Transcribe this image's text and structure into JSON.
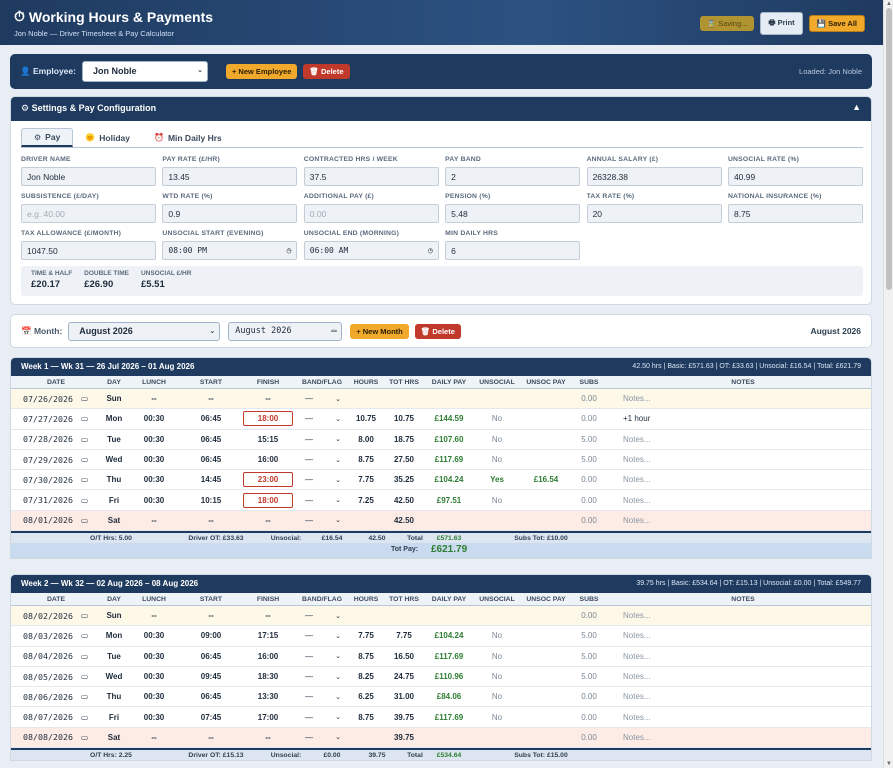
{
  "app": {
    "title": "Working Hours & Payments",
    "subtitle": "Jon Noble — Driver Timesheet & Pay Calculator",
    "saving": "Saving...",
    "print": "Print",
    "save_all": "Save All"
  },
  "employee": {
    "label": "Employee:",
    "selected": "Jon Noble",
    "new_button": "+ New Employee",
    "delete_button": "Delete",
    "loaded": "Loaded: Jon Noble"
  },
  "settings": {
    "title": "Settings & Pay Configuration",
    "tabs": [
      {
        "label": "Pay",
        "icon": "gear-icon"
      },
      {
        "label": "Holiday",
        "icon": "sun-icon"
      },
      {
        "label": "Min Daily Hrs",
        "icon": "alarm-clock-icon"
      }
    ],
    "fields": [
      {
        "label": "DRIVER NAME",
        "value": "Jon Noble"
      },
      {
        "label": "PAY RATE (£/HR)",
        "value": "13.45"
      },
      {
        "label": "CONTRACTED HRS / WEEK",
        "value": "37.5"
      },
      {
        "label": "PAY BAND",
        "value": "2"
      },
      {
        "label": "ANNUAL SALARY (£)",
        "value": "26328.38"
      },
      {
        "label": "UNSOCIAL RATE (%)",
        "value": "40.99"
      },
      {
        "label": "SUBSISTENCE (£/DAY)",
        "placeholder": "e.g. 40.00"
      },
      {
        "label": "WTD RATE (%)",
        "value": "0.9"
      },
      {
        "label": "ADDITIONAL PAY (£)",
        "placeholder": "0.00"
      },
      {
        "label": "PENSION (%)",
        "value": "5.48"
      },
      {
        "label": "TAX RATE (%)",
        "value": "20"
      },
      {
        "label": "NATIONAL INSURANCE (%)",
        "value": "8.75"
      },
      {
        "label": "TAX ALLOWANCE (£/MONTH)",
        "value": "1047.50"
      },
      {
        "label": "UNSOCIAL START (EVENING)",
        "value": "08:00 PM",
        "type": "time"
      },
      {
        "label": "UNSOCIAL END (MORNING)",
        "value": "06:00 AM",
        "type": "time"
      },
      {
        "label": "MIN DAILY HRS",
        "value": "6"
      }
    ],
    "rates": [
      {
        "label": "TIME & HALF",
        "value": "£20.17"
      },
      {
        "label": "DOUBLE TIME",
        "value": "£26.90"
      },
      {
        "label": "UNSOCIAL £/HR",
        "value": "£5.51"
      }
    ]
  },
  "month": {
    "label": "Month:",
    "selected": "August 2026",
    "input_value": "August 2026",
    "new_button": "+ New Month",
    "delete_button": "Delete",
    "current": "August 2026"
  },
  "columns": [
    "DATE",
    "DAY",
    "LUNCH",
    "START",
    "FINISH",
    "BAND/FLAG",
    "HOURS",
    "TOT HRS",
    "DAILY PAY",
    "UNSOCIAL",
    "UNSOC PAY",
    "SUBS",
    "NOTES"
  ],
  "weeks": [
    {
      "title": "Week 1 — Wk 31 — 26 Jul 2026 – 01 Aug 2026",
      "stats": "42.50 hrs | Basic: £571.63 | OT: £33.63 | Unsocial: £16.54 | Total: £621.79",
      "rows": [
        {
          "date": "07/26/2026",
          "day": "Sun",
          "lunch": "--",
          "start": "--",
          "finish": "--",
          "band": "—",
          "hours": "",
          "tot": "",
          "pay": "",
          "unsoc": "",
          "unsocpay": "",
          "subs": "0.00",
          "notes": "Notes...",
          "kind": "sun"
        },
        {
          "date": "07/27/2026",
          "day": "Mon",
          "lunch": "00:30",
          "start": "06:45",
          "finish": "18:00",
          "flag": true,
          "band": "—",
          "hours": "10.75",
          "tot": "10.75",
          "pay": "£144.59",
          "unsoc": "No",
          "unsocpay": "",
          "subs": "0.00",
          "notes": "+1 hour",
          "notes_filled": true
        },
        {
          "date": "07/28/2026",
          "day": "Tue",
          "lunch": "00:30",
          "start": "06:45",
          "finish": "15:15",
          "band": "—",
          "hours": "8.00",
          "tot": "18.75",
          "pay": "£107.60",
          "unsoc": "No",
          "unsocpay": "",
          "subs": "5.00",
          "notes": "Notes..."
        },
        {
          "date": "07/29/2026",
          "day": "Wed",
          "lunch": "00:30",
          "start": "06:45",
          "finish": "16:00",
          "band": "—",
          "hours": "8.75",
          "tot": "27.50",
          "pay": "£117.69",
          "unsoc": "No",
          "unsocpay": "",
          "subs": "5.00",
          "notes": "Notes..."
        },
        {
          "date": "07/30/2026",
          "day": "Thu",
          "lunch": "00:30",
          "start": "14:45",
          "finish": "23:00",
          "flag": true,
          "band": "—",
          "hours": "7.75",
          "tot": "35.25",
          "pay": "£104.24",
          "unsoc": "Yes",
          "unsocpay": "£16.54",
          "subs": "0.00",
          "notes": "Notes..."
        },
        {
          "date": "07/31/2026",
          "day": "Fri",
          "lunch": "00:30",
          "start": "10:15",
          "finish": "18:00",
          "flag": true,
          "band": "—",
          "hours": "7.25",
          "tot": "42.50",
          "pay": "£97.51",
          "unsoc": "No",
          "unsocpay": "",
          "subs": "0.00",
          "notes": "Notes..."
        },
        {
          "date": "08/01/2026",
          "day": "Sat",
          "lunch": "--",
          "start": "--",
          "finish": "--",
          "band": "—",
          "hours": "",
          "tot": "42.50",
          "pay": "",
          "unsoc": "",
          "unsocpay": "",
          "subs": "0.00",
          "notes": "Notes...",
          "kind": "sat"
        }
      ],
      "summary": {
        "ot_hrs": "O/T Hrs: 5.00",
        "driver_ot": "Driver OT: £33.63",
        "unsocial_label": "Unsocial:",
        "unsocial": "£16.54",
        "hours": "42.50",
        "total_label": "Total",
        "total": "£571.63",
        "subs_tot": "Subs Tot: £10.00"
      },
      "tot_pay_label": "Tot Pay:",
      "tot_pay": "£621.79"
    },
    {
      "title": "Week 2 — Wk 32 — 02 Aug 2026 – 08 Aug 2026",
      "stats": "39.75 hrs | Basic: £534.64 | OT: £15.13 | Unsocial: £0.00 | Total: £549.77",
      "rows": [
        {
          "date": "08/02/2026",
          "day": "Sun",
          "lunch": "--",
          "start": "--",
          "finish": "--",
          "band": "—",
          "hours": "",
          "tot": "",
          "pay": "",
          "unsoc": "",
          "unsocpay": "",
          "subs": "0.00",
          "notes": "Notes...",
          "kind": "sun"
        },
        {
          "date": "08/03/2026",
          "day": "Mon",
          "lunch": "00:30",
          "start": "09:00",
          "finish": "17:15",
          "band": "—",
          "hours": "7.75",
          "tot": "7.75",
          "pay": "£104.24",
          "unsoc": "No",
          "unsocpay": "",
          "subs": "5.00",
          "notes": "Notes..."
        },
        {
          "date": "08/04/2026",
          "day": "Tue",
          "lunch": "00:30",
          "start": "06:45",
          "finish": "16:00",
          "band": "—",
          "hours": "8.75",
          "tot": "16.50",
          "pay": "£117.69",
          "unsoc": "No",
          "unsocpay": "",
          "subs": "5.00",
          "notes": "Notes..."
        },
        {
          "date": "08/05/2026",
          "day": "Wed",
          "lunch": "00:30",
          "start": "09:45",
          "finish": "18:30",
          "band": "—",
          "hours": "8.25",
          "tot": "24.75",
          "pay": "£110.96",
          "unsoc": "No",
          "unsocpay": "",
          "subs": "5.00",
          "notes": "Notes..."
        },
        {
          "date": "08/06/2026",
          "day": "Thu",
          "lunch": "00:30",
          "start": "06:45",
          "finish": "13:30",
          "band": "—",
          "hours": "6.25",
          "tot": "31.00",
          "pay": "£84.06",
          "unsoc": "No",
          "unsocpay": "",
          "subs": "0.00",
          "notes": "Notes..."
        },
        {
          "date": "08/07/2026",
          "day": "Fri",
          "lunch": "00:30",
          "start": "07:45",
          "finish": "17:00",
          "band": "—",
          "hours": "8.75",
          "tot": "39.75",
          "pay": "£117.69",
          "unsoc": "No",
          "unsocpay": "",
          "subs": "0.00",
          "notes": "Notes..."
        },
        {
          "date": "08/08/2026",
          "day": "Sat",
          "lunch": "--",
          "start": "--",
          "finish": "--",
          "band": "—",
          "hours": "",
          "tot": "39.75",
          "pay": "",
          "unsoc": "",
          "unsocpay": "",
          "subs": "0.00",
          "notes": "Notes...",
          "kind": "sat"
        }
      ],
      "summary": {
        "ot_hrs": "O/T Hrs: 2.25",
        "driver_ot": "Driver OT: £15.13",
        "unsocial_label": "Unsocial:",
        "unsocial": "£0.00",
        "hours": "39.75",
        "total_label": "Total",
        "total": "£534.64",
        "subs_tot": "Subs Tot: £15.00"
      }
    }
  ]
}
